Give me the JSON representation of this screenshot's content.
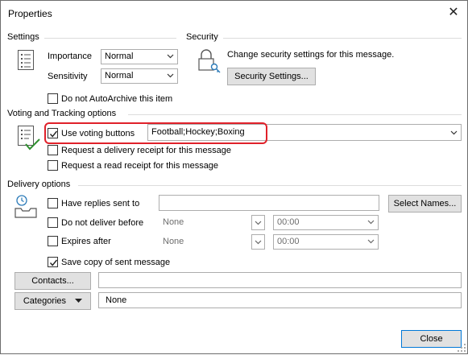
{
  "window": {
    "title": "Properties",
    "close_glyph": "✕"
  },
  "settings": {
    "heading": "Settings",
    "importance_label": "Importance",
    "importance_value": "Normal",
    "sensitivity_label": "Sensitivity",
    "sensitivity_value": "Normal",
    "autoarchive_label": "Do not AutoArchive this item",
    "autoarchive_checked": false
  },
  "security": {
    "heading": "Security",
    "description": "Change security settings for this message.",
    "button_label": "Security Settings..."
  },
  "voting": {
    "heading": "Voting and Tracking options",
    "use_voting_label": "Use voting buttons",
    "use_voting_checked": true,
    "voting_value": "Football;Hockey;Boxing",
    "delivery_receipt_label": "Request a delivery receipt for this message",
    "read_receipt_label": "Request a read receipt for this message",
    "highlight_color": "#e0212a"
  },
  "delivery": {
    "heading": "Delivery options",
    "have_replies_label": "Have replies sent to",
    "have_replies_value": "",
    "select_names_label": "Select Names...",
    "do_not_deliver_label": "Do not deliver before",
    "do_not_deliver_date": "None",
    "do_not_deliver_time": "00:00",
    "expires_label": "Expires after",
    "expires_date": "None",
    "expires_time": "00:00",
    "save_copy_label": "Save copy of sent message",
    "save_copy_checked": true
  },
  "contacts": {
    "button_label": "Contacts...",
    "value": ""
  },
  "categories": {
    "button_label": "Categories",
    "value": "None"
  },
  "footer": {
    "close_label": "Close"
  },
  "colors": {
    "accent": "#0078d7",
    "check_green": "#2f8f2f"
  }
}
